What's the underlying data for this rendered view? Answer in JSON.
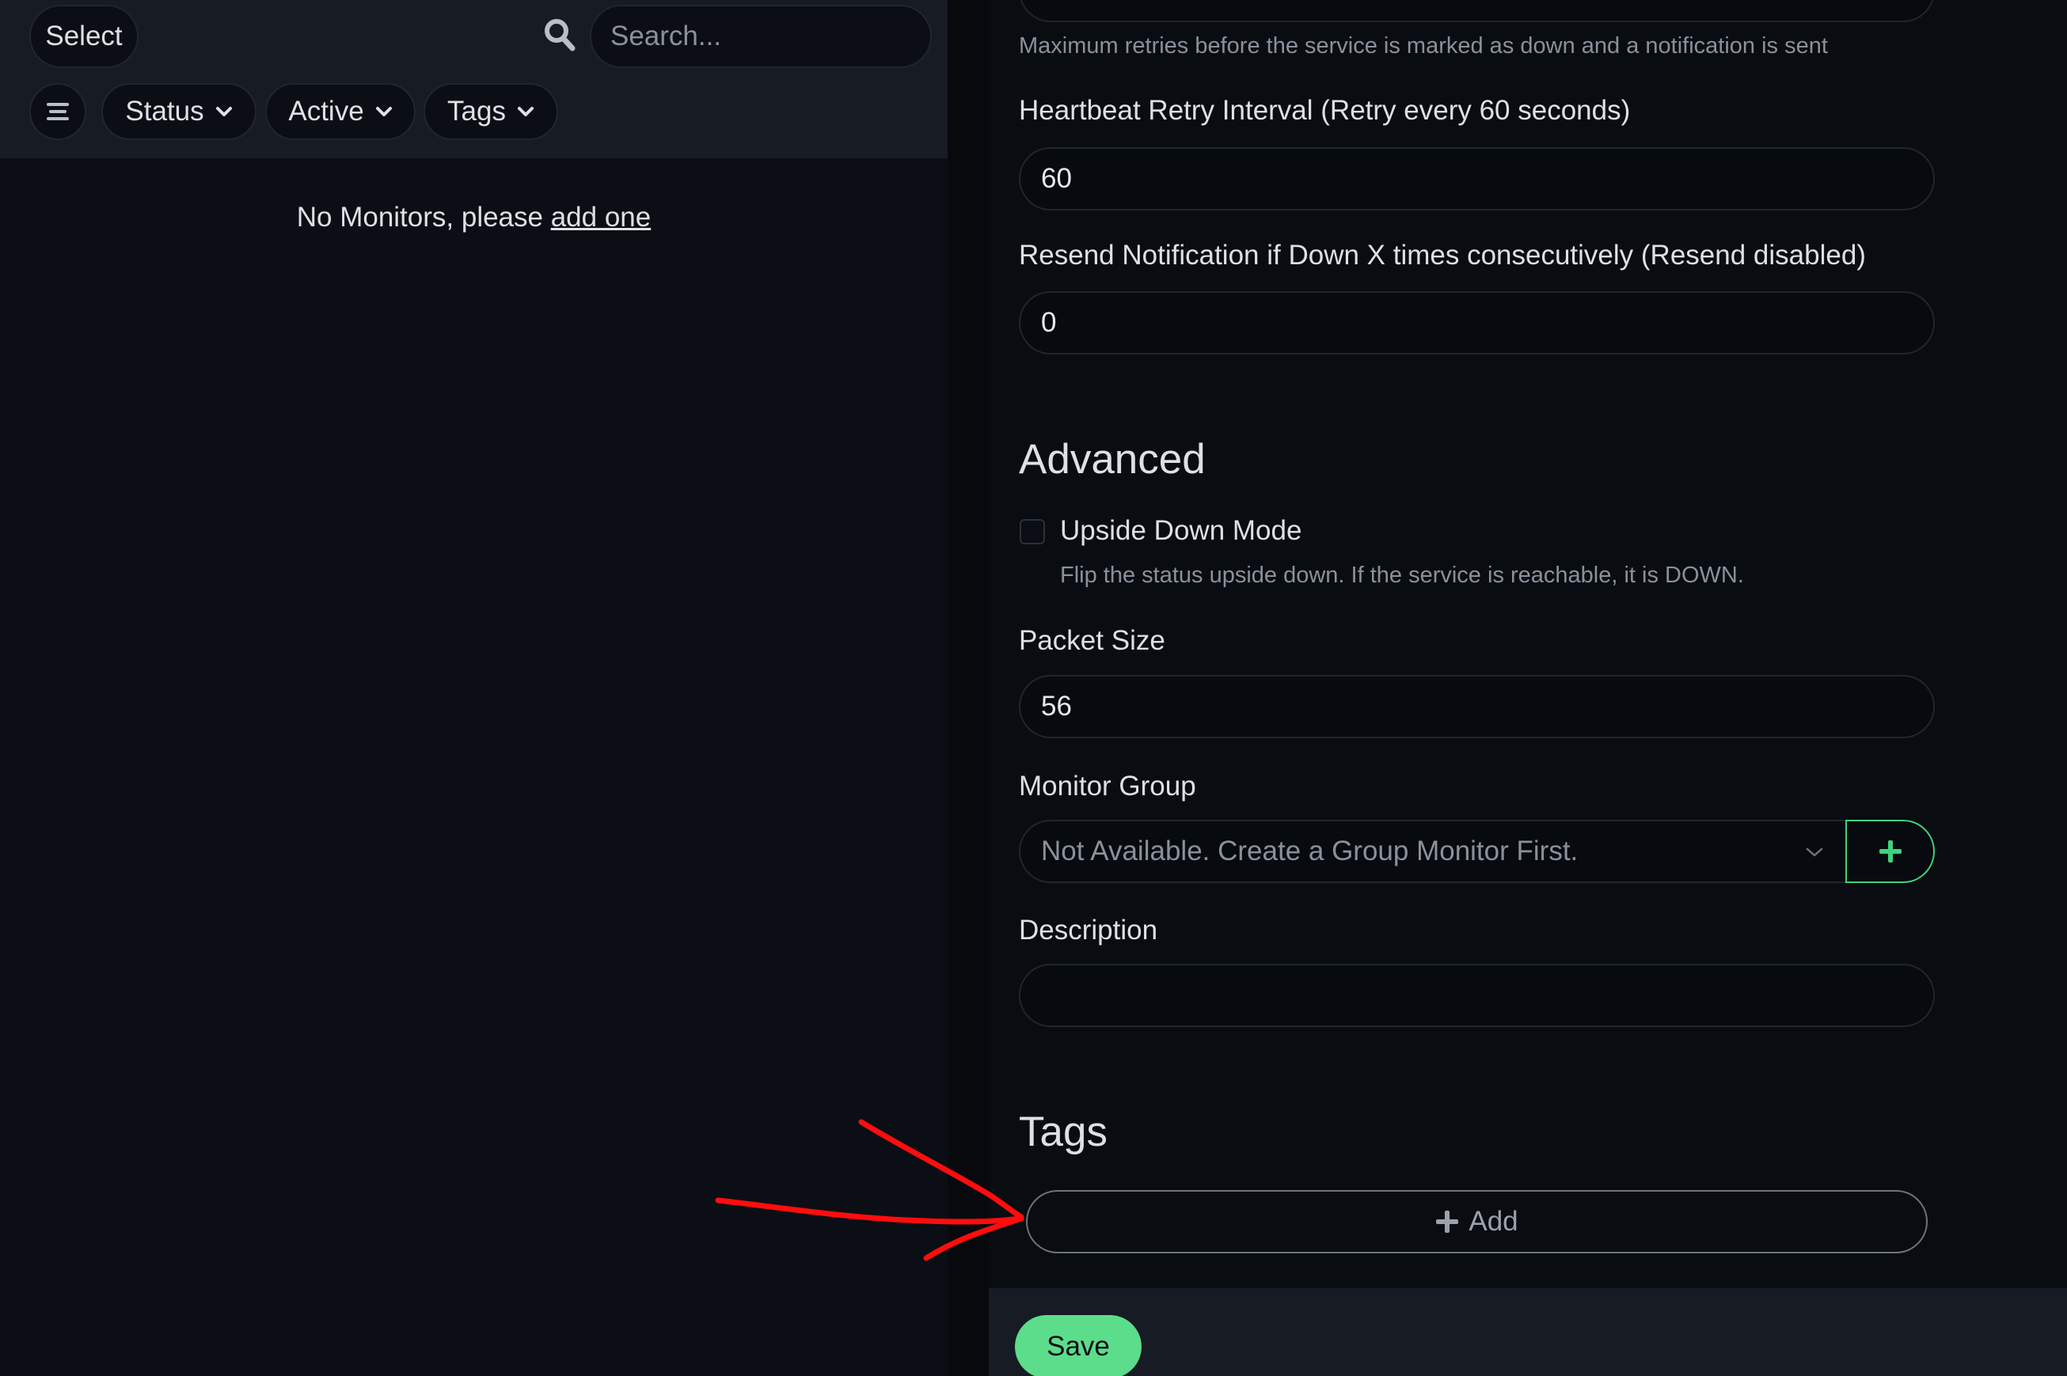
{
  "left_panel": {
    "select_label": "Select",
    "search_placeholder": "Search...",
    "filters": {
      "status": "Status",
      "active": "Active",
      "tags": "Tags"
    },
    "empty_message": "No Monitors, please ",
    "empty_link": "add one"
  },
  "form": {
    "max_retries_help": "Maximum retries before the service is marked as down and a notification is sent",
    "retry_interval_label": "Heartbeat Retry Interval (Retry every 60 seconds)",
    "retry_interval_value": "60",
    "resend_label": "Resend Notification if Down X times consecutively (Resend disabled)",
    "resend_value": "0",
    "advanced_title": "Advanced",
    "upside_down_label": "Upside Down Mode",
    "upside_down_help": "Flip the status upside down. If the service is reachable, it is DOWN.",
    "packet_size_label": "Packet Size",
    "packet_size_value": "56",
    "monitor_group_label": "Monitor Group",
    "monitor_group_value": "Not Available. Create a Group Monitor First.",
    "description_label": "Description",
    "description_value": "",
    "tags_title": "Tags",
    "tags_add_label": "Add",
    "save_label": "Save"
  },
  "colors": {
    "accent": "#5cdd8b",
    "annotation_arrow": "#ff0d0d"
  },
  "icons": {
    "search": "search-icon",
    "menu": "list-icon",
    "chevron": "chevron-down-icon",
    "plus": "plus-icon",
    "annotation": "red-arrow-annotation"
  }
}
